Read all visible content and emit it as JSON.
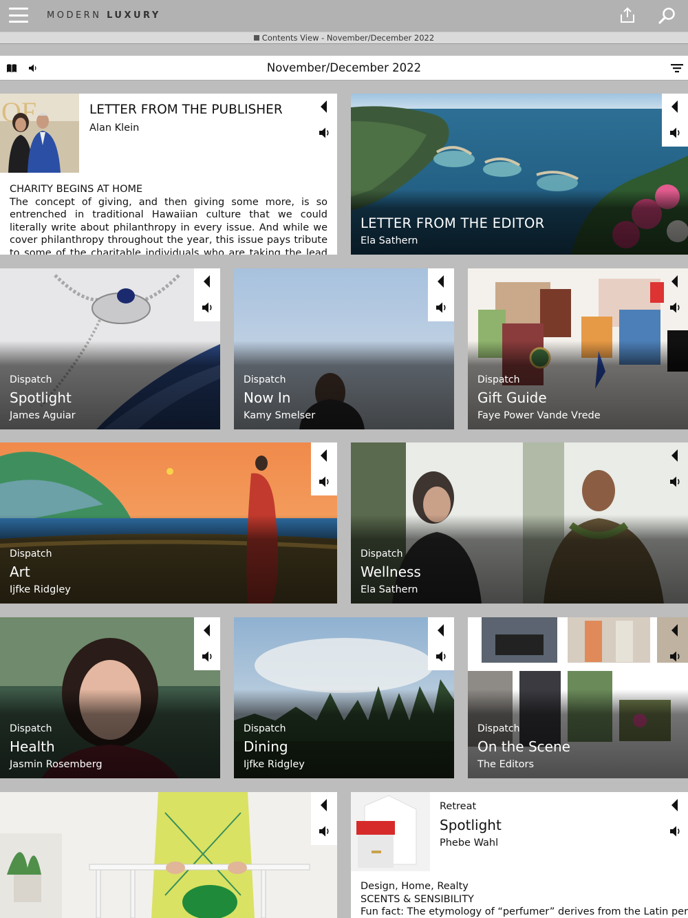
{
  "app": {
    "logo_light": "MODERN ",
    "logo_bold": "LUXURY",
    "subbar_text": "Contents View - November/December 2022",
    "issue_title": "November/December 2022"
  },
  "icons": [
    "hamburger-menu-icon",
    "share-icon",
    "search-icon",
    "book-icon",
    "speaker-icon",
    "filter-icon",
    "play-icon"
  ],
  "colors": {
    "topbar": "#b2b2b2",
    "background": "#bdbdbd",
    "text": "#111111"
  },
  "publisher": {
    "title": "LETTER FROM THE PUBLISHER",
    "author": "Alan Klein",
    "kicker": "CHARITY BEGINS AT HOME",
    "excerpt": "The concept of giving, and then giving some more, is so entrenched in traditional Hawaiian culture that we could literally write about philanthropy in every issue. And while we cover philanthropy throughout the year, this issue pays tribute to some of the charitable individuals who are taking the lead on a new era of philanthropy."
  },
  "editor": {
    "title": "LETTER FROM THE EDITOR",
    "author": "Ela Sathern"
  },
  "articles": [
    {
      "section": "Dispatch",
      "title": "Spotlight",
      "author": "James Aguiar"
    },
    {
      "section": "Dispatch",
      "title": "Now In",
      "author": "Kamy Smelser"
    },
    {
      "section": "Dispatch",
      "title": "Gift Guide",
      "author": "Faye Power Vande Vrede"
    },
    {
      "section": "Dispatch",
      "title": "Art",
      "author": "Ijfke Ridgley"
    },
    {
      "section": "Dispatch",
      "title": "Wellness",
      "author": "Ela Sathern"
    },
    {
      "section": "Dispatch",
      "title": "Health",
      "author": "Jasmin Rosemberg"
    },
    {
      "section": "Dispatch",
      "title": "Dining",
      "author": "Ijfke Ridgley"
    },
    {
      "section": "Dispatch",
      "title": "On the Scene",
      "author": "The Editors"
    }
  ],
  "retreat": {
    "section": "Retreat",
    "title": "Spotlight",
    "author": "Phebe Wahl",
    "tags": "Design, Home, Realty",
    "kicker": "SCENTS & SENSIBILITY",
    "excerpt": "Fun fact: The etymology of “perfumer” derives from the Latin per"
  }
}
